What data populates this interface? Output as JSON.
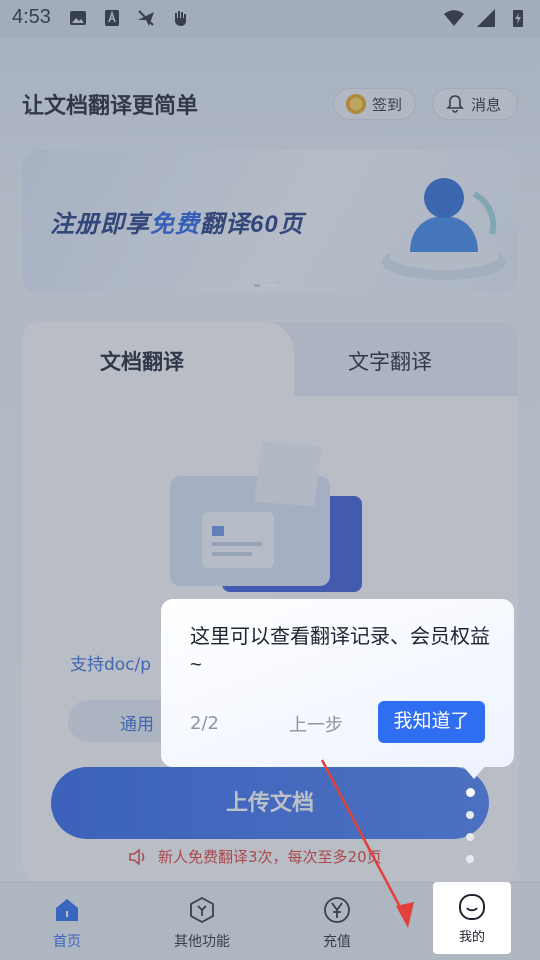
{
  "status_bar": {
    "time": "4:53"
  },
  "header": {
    "title": "让文档翻译更简单",
    "signin_label": "签到",
    "message_label": "消息"
  },
  "banner": {
    "text_pre": "注册即享",
    "text_highlight": "免费",
    "text_post": "翻译60页"
  },
  "card": {
    "tabs": [
      {
        "label": "文档翻译"
      },
      {
        "label": "文字翻译"
      }
    ],
    "support_text": "支持doc/p",
    "common_button": "通用"
  },
  "upload_button": "上传文档",
  "promo_text": "新人免费翻译3次，每次至多20页",
  "guide": {
    "text": "这里可以查看翻译记录、会员权益~",
    "page": "2/2",
    "prev_label": "上一步",
    "ok_label": "我知道了"
  },
  "bottom_nav": {
    "items": [
      {
        "label": "首页",
        "icon": "home-icon"
      },
      {
        "label": "其他功能",
        "icon": "hexagon-y-icon"
      },
      {
        "label": "充值",
        "icon": "yen-circle-icon"
      },
      {
        "label": "我的",
        "icon": "smile-icon"
      }
    ]
  },
  "colors": {
    "accent": "#2f6df1",
    "promo": "#e2403b",
    "banner_title": "#233a80"
  }
}
